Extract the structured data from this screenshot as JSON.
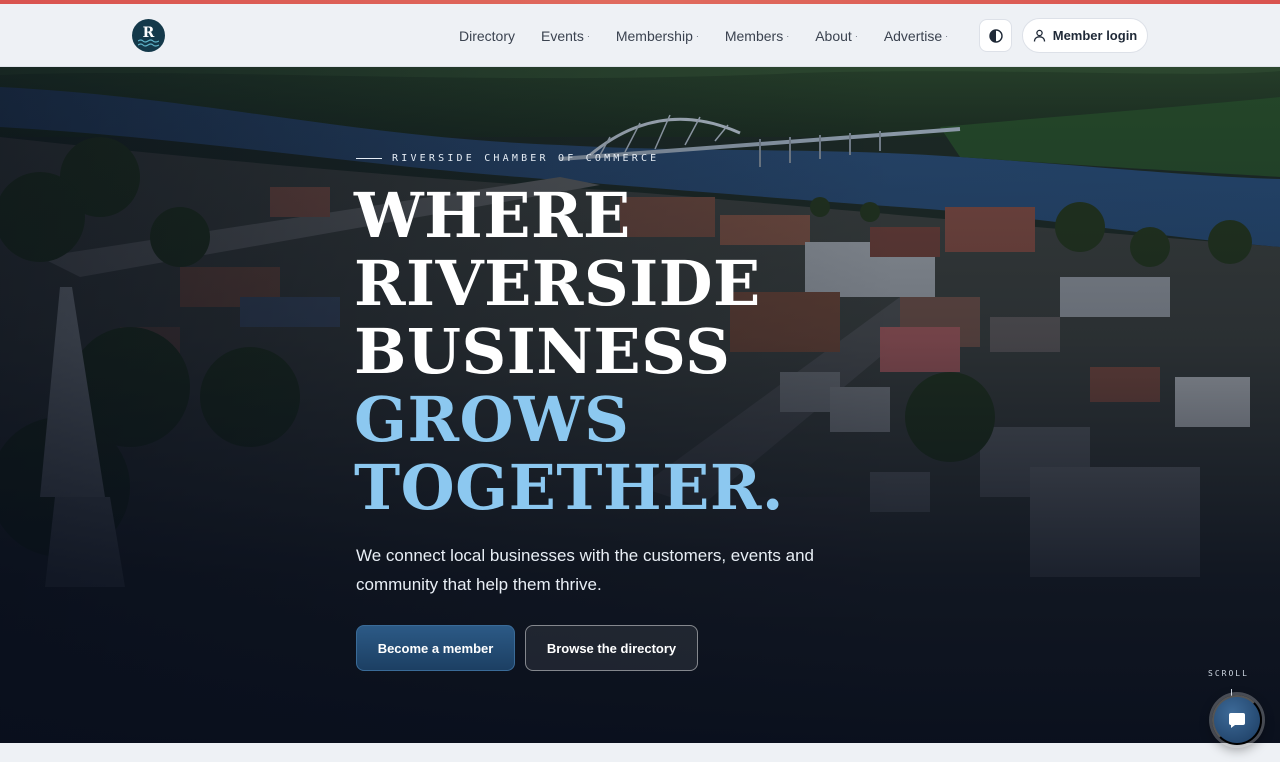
{
  "header": {
    "logo_letter": "R",
    "nav": [
      {
        "label": "Directory",
        "has_dropdown": false
      },
      {
        "label": "Events",
        "has_dropdown": true
      },
      {
        "label": "Membership",
        "has_dropdown": true
      },
      {
        "label": "Members",
        "has_dropdown": true
      },
      {
        "label": "About",
        "has_dropdown": true
      },
      {
        "label": "Advertise",
        "has_dropdown": true
      }
    ],
    "dropdown_marker": "·",
    "theme_toggle_icon": "contrast-icon",
    "login_label": "Member login",
    "login_icon": "user-icon"
  },
  "hero": {
    "eyebrow": "RIVERSIDE CHAMBER OF COMMERCE",
    "headline_white": [
      "WHERE",
      "RIVERSIDE",
      "BUSINESS"
    ],
    "headline_blue": [
      "GROWS",
      "TOGETHER."
    ],
    "subcopy": "We connect local businesses with the customers, events and community that help them thrive.",
    "cta_primary": "Become a member",
    "cta_secondary": "Browse the directory",
    "scroll_label": "SCROLL"
  },
  "chat": {
    "icon": "chat-bubble-icon"
  },
  "colors": {
    "accent_bar": "#d9534f",
    "headline_blue": "#8cc8f0",
    "primary_button": "#1c3f63",
    "logo_bg": "#14394a"
  }
}
